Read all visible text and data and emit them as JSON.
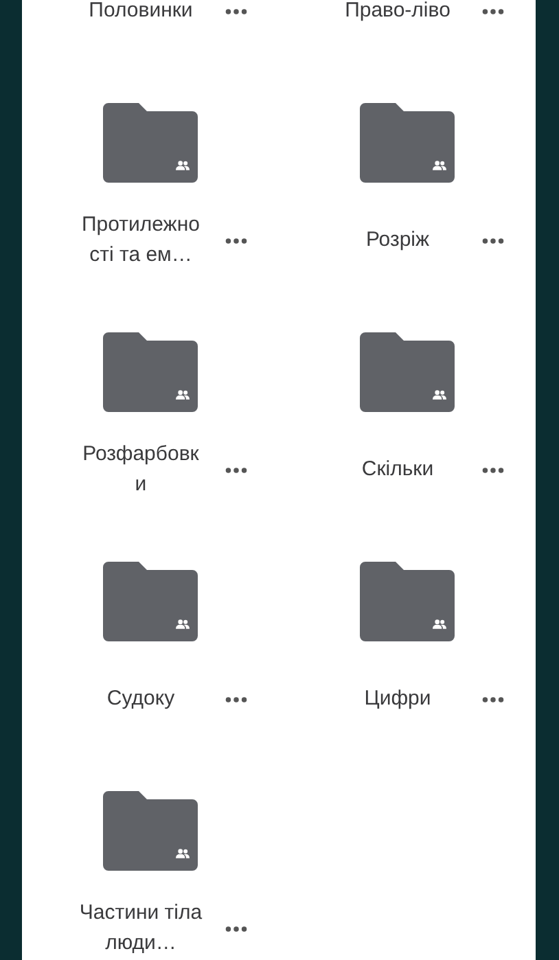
{
  "folders": [
    {
      "kind": "cut",
      "name": "Половинки"
    },
    {
      "kind": "cut",
      "name": "Право-ліво"
    },
    {
      "kind": "folder",
      "name": "Протилежності та ем…",
      "shared": true
    },
    {
      "kind": "folder",
      "name": "Розріж",
      "shared": true
    },
    {
      "kind": "folder",
      "name": "Розфарбовки",
      "shared": true
    },
    {
      "kind": "folder",
      "name": "Скільки",
      "shared": true
    },
    {
      "kind": "folder",
      "name": "Судоку",
      "shared": true
    },
    {
      "kind": "folder",
      "name": "Цифри",
      "shared": true
    },
    {
      "kind": "folder",
      "name": "Частини тіла люди…",
      "shared": true
    }
  ]
}
